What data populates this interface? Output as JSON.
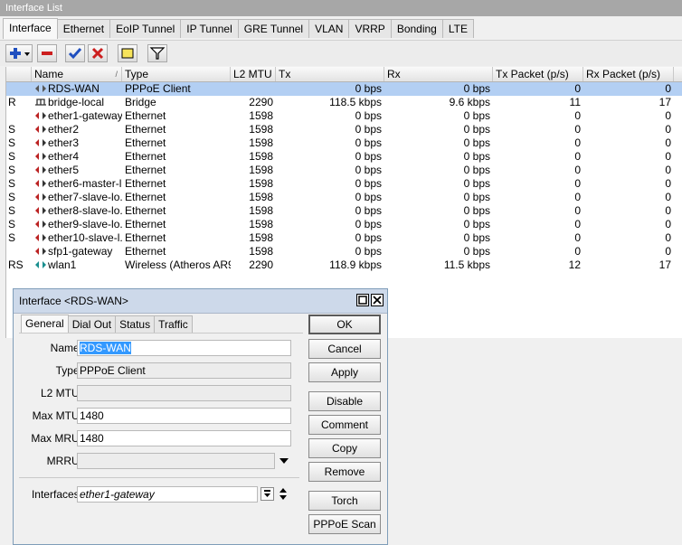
{
  "window": {
    "title": "Interface List"
  },
  "tabs": [
    "Interface",
    "Ethernet",
    "EoIP Tunnel",
    "IP Tunnel",
    "GRE Tunnel",
    "VLAN",
    "VRRP",
    "Bonding",
    "LTE"
  ],
  "columns": [
    "Name",
    "Type",
    "L2 MTU",
    "Tx",
    "Rx",
    "Tx Packet (p/s)",
    "Rx Packet (p/s)"
  ],
  "rows": [
    {
      "flag": "",
      "icon": "pppoe-icon",
      "name": "RDS-WAN",
      "type": "PPPoE Client",
      "mtu": "",
      "tx": "0 bps",
      "rx": "0 bps",
      "txp": "0",
      "rxp": "0"
    },
    {
      "flag": "R",
      "icon": "bridge-icon",
      "name": "bridge-local",
      "type": "Bridge",
      "mtu": "2290",
      "tx": "118.5 kbps",
      "rx": "9.6 kbps",
      "txp": "11",
      "rxp": "17"
    },
    {
      "flag": "",
      "icon": "ethernet-icon",
      "name": "ether1-gateway",
      "type": "Ethernet",
      "mtu": "1598",
      "tx": "0 bps",
      "rx": "0 bps",
      "txp": "0",
      "rxp": "0"
    },
    {
      "flag": "S",
      "icon": "ethernet-icon",
      "name": "ether2",
      "type": "Ethernet",
      "mtu": "1598",
      "tx": "0 bps",
      "rx": "0 bps",
      "txp": "0",
      "rxp": "0"
    },
    {
      "flag": "S",
      "icon": "ethernet-icon",
      "name": "ether3",
      "type": "Ethernet",
      "mtu": "1598",
      "tx": "0 bps",
      "rx": "0 bps",
      "txp": "0",
      "rxp": "0"
    },
    {
      "flag": "S",
      "icon": "ethernet-icon",
      "name": "ether4",
      "type": "Ethernet",
      "mtu": "1598",
      "tx": "0 bps",
      "rx": "0 bps",
      "txp": "0",
      "rxp": "0"
    },
    {
      "flag": "S",
      "icon": "ethernet-icon",
      "name": "ether5",
      "type": "Ethernet",
      "mtu": "1598",
      "tx": "0 bps",
      "rx": "0 bps",
      "txp": "0",
      "rxp": "0"
    },
    {
      "flag": "S",
      "icon": "ethernet-icon",
      "name": "ether6-master-l...",
      "type": "Ethernet",
      "mtu": "1598",
      "tx": "0 bps",
      "rx": "0 bps",
      "txp": "0",
      "rxp": "0"
    },
    {
      "flag": "S",
      "icon": "ethernet-icon",
      "name": "ether7-slave-lo...",
      "type": "Ethernet",
      "mtu": "1598",
      "tx": "0 bps",
      "rx": "0 bps",
      "txp": "0",
      "rxp": "0"
    },
    {
      "flag": "S",
      "icon": "ethernet-icon",
      "name": "ether8-slave-lo...",
      "type": "Ethernet",
      "mtu": "1598",
      "tx": "0 bps",
      "rx": "0 bps",
      "txp": "0",
      "rxp": "0"
    },
    {
      "flag": "S",
      "icon": "ethernet-icon",
      "name": "ether9-slave-lo...",
      "type": "Ethernet",
      "mtu": "1598",
      "tx": "0 bps",
      "rx": "0 bps",
      "txp": "0",
      "rxp": "0"
    },
    {
      "flag": "S",
      "icon": "ethernet-icon",
      "name": "ether10-slave-l...",
      "type": "Ethernet",
      "mtu": "1598",
      "tx": "0 bps",
      "rx": "0 bps",
      "txp": "0",
      "rxp": "0"
    },
    {
      "flag": "",
      "icon": "ethernet-icon",
      "name": "sfp1-gateway",
      "type": "Ethernet",
      "mtu": "1598",
      "tx": "0 bps",
      "rx": "0 bps",
      "txp": "0",
      "rxp": "0"
    },
    {
      "flag": "RS",
      "icon": "wireless-icon",
      "name": "wlan1",
      "type": "Wireless (Atheros AR9...",
      "mtu": "2290",
      "tx": "118.9 kbps",
      "rx": "11.5 kbps",
      "txp": "12",
      "rxp": "17"
    }
  ],
  "dialog": {
    "title": "Interface <RDS-WAN>",
    "tabs": [
      "General",
      "Dial Out",
      "Status",
      "Traffic"
    ],
    "fields": {
      "name_label": "Name:",
      "name_value": "RDS-WAN",
      "type_label": "Type:",
      "type_value": "PPPoE Client",
      "l2mtu_label": "L2 MTU:",
      "l2mtu_value": "",
      "maxmtu_label": "Max MTU:",
      "maxmtu_value": "1480",
      "maxmru_label": "Max MRU:",
      "maxmru_value": "1480",
      "mrru_label": "MRRU:",
      "mrru_value": "",
      "interfaces_label": "Interfaces:",
      "interfaces_value": "ether1-gateway"
    },
    "buttons": [
      "OK",
      "Cancel",
      "Apply",
      "Disable",
      "Comment",
      "Copy",
      "Remove",
      "Torch",
      "PPPoE Scan"
    ]
  },
  "colors": {
    "selection": "#b3cff3",
    "add": "#1f4fbf",
    "remove": "#cc1f1f",
    "check": "#1f4fbf"
  }
}
